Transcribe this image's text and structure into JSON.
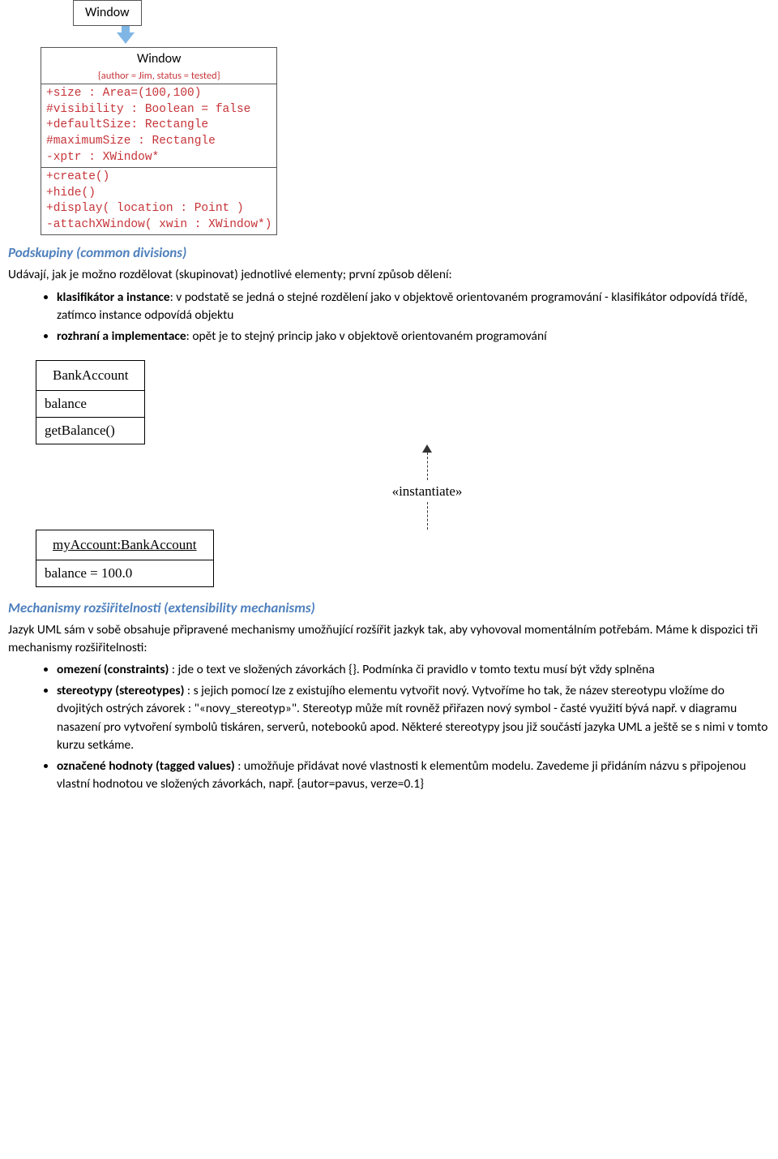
{
  "uml_window": {
    "top_box_label": "Window",
    "class_name": "Window",
    "tagged": "{author = Jim, status = tested}",
    "attributes": [
      "+size : Area=(100,100)",
      "#visibility : Boolean = false",
      "+defaultSize: Rectangle",
      "#maximumSize : Rectangle",
      "-xptr : XWindow*"
    ],
    "operations": [
      "+create()",
      "+hide()",
      "+display( location : Point )",
      "-attachXWindow( xwin : XWindow*)"
    ]
  },
  "section1": {
    "heading": "Podskupiny (common divisions)",
    "intro": "Udávají, jak je možno rozdělovat (skupinovat) jednotlivé elementy; první způsob dělení:",
    "bullets": [
      {
        "bold": "klasifikátor a instance",
        "rest": ": v podstatě se jedná o stejné rozdělení jako v objektově orientovaném programování - klasifikátor odpovídá třídě, zatímco instance odpovídá objektu"
      },
      {
        "bold": "rozhraní a implementace",
        "rest": ": opět je to stejný princip jako v objektově orientovaném programování"
      }
    ]
  },
  "uml_bank": {
    "class_name": "BankAccount",
    "attr": "balance",
    "op": "getBalance()",
    "stereotype": "«instantiate»",
    "instance_name": "myAccount:BankAccount",
    "instance_attr": "balance = 100.0"
  },
  "section2": {
    "heading": "Mechanismy rozšiřitelnosti (extensibility mechanisms)",
    "intro": "Jazyk UML sám v sobě obsahuje připravené mechanismy umožňující rozšířit jazkyk tak, aby vyhovoval momentálním potřebám. Máme k dispozici tři mechanismy rozšiřitelnosti:",
    "bullets": [
      {
        "bold": "omezení (constraints)",
        "rest": " : jde o text ve složených závorkách {}. Podmínka či pravidlo v tomto textu musí být vždy splněna"
      },
      {
        "bold": "stereotypy (stereotypes)",
        "rest": " : s jejich pomocí lze z existujího elementu vytvořit nový. Vytvoříme ho tak, že název stereotypu vložíme do dvojitých ostrých závorek : \"«novy_stereotyp»\". Stereotyp může mít rovněž přiřazen nový symbol - časté využití bývá např. v diagramu nasazení pro vytvoření symbolů tiskáren, serverů, notebooků apod. Některé stereotypy jsou již součástí jazyka UML a ještě se s nimi v tomto kurzu setkáme."
      },
      {
        "bold": "označené hodnoty (tagged values)",
        "rest": " : umožňuje přidávat nové vlastnosti k elementům modelu. Zavedeme ji přidáním názvu s připojenou vlastní hodnotou ve složených závorkách, např. {autor=pavus, verze=0.1}"
      }
    ]
  }
}
